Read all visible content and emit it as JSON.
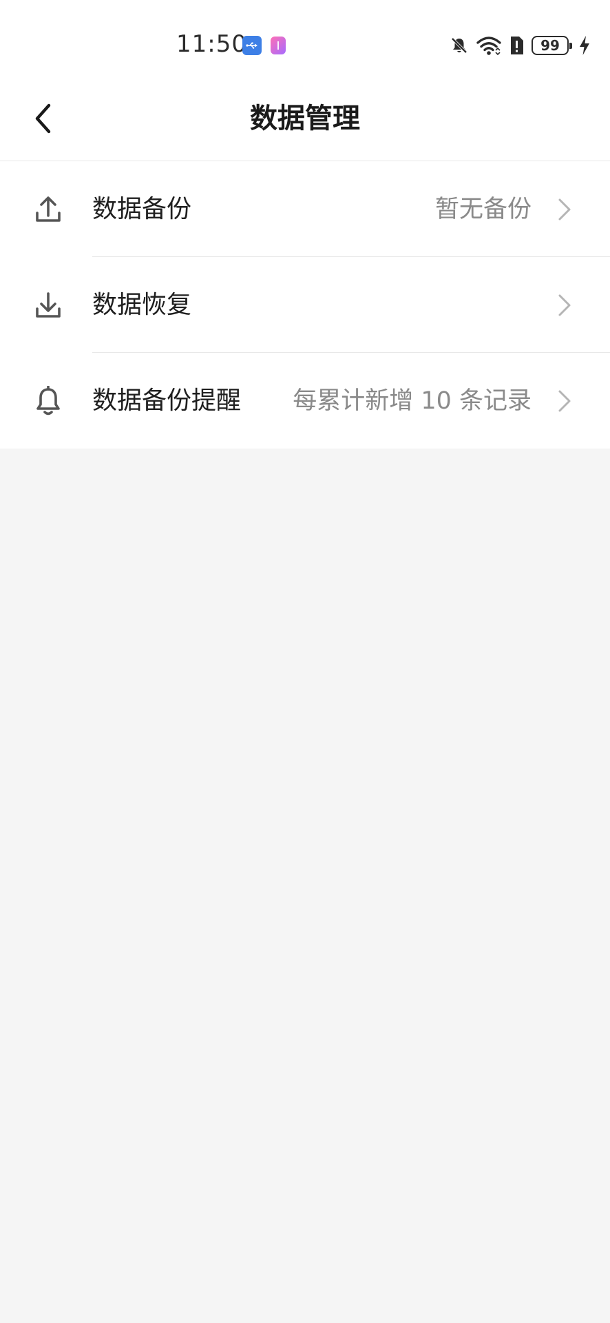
{
  "status_bar": {
    "time": "11:50",
    "battery": "99",
    "icons": [
      "usb-icon",
      "app-notification-icon",
      "mute-bell-icon",
      "wifi-icon",
      "alert-icon",
      "battery-icon",
      "charging-icon"
    ]
  },
  "nav": {
    "title": "数据管理",
    "back_icon": "back-arrow-icon"
  },
  "list": {
    "items": [
      {
        "label": "数据备份",
        "value": "暂无备份",
        "icon": "upload-icon"
      },
      {
        "label": "数据恢复",
        "value": "",
        "icon": "download-icon"
      },
      {
        "label": "数据备份提醒",
        "value": "每累计新增 10 条记录",
        "icon": "bell-icon"
      }
    ]
  },
  "colors": {
    "background": "#f5f5f5",
    "surface": "#ffffff",
    "text_primary": "#1f1f1f",
    "text_secondary": "#8a8a8a",
    "divider": "#e8e8e8",
    "icon": "#555555",
    "chevron": "#b5b5b5"
  }
}
